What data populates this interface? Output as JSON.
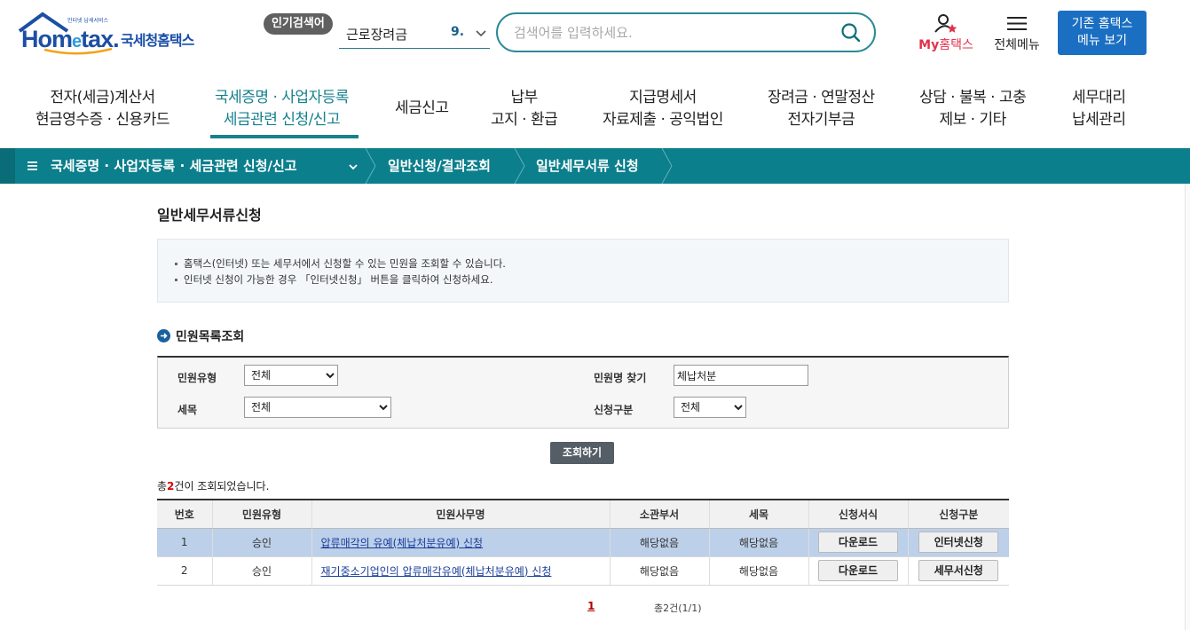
{
  "header": {
    "logo_tagline": "인터넷 납세서비스",
    "logo_word_a": "Hom",
    "logo_word_e": "e",
    "logo_word_b": "tax.",
    "logo_korean": "국세청홈택스",
    "popular_badge": "인기검색어",
    "popular_term": "근로장려금",
    "popular_rank": "9.",
    "search_placeholder": "검색어를 입력하세요.",
    "my_prefix": "My",
    "my_suffix": "홈택스",
    "all_menu": "전체메뉴",
    "old_menu_line1": "기존 홈택스",
    "old_menu_line2": "메뉴 보기"
  },
  "nav": {
    "items": [
      {
        "line1": "전자(세금)계산서",
        "line2": "현금영수증 · 신용카드"
      },
      {
        "line1": "국세증명 · 사업자등록",
        "line2": "세금관련 신청/신고"
      },
      {
        "line1": "세금신고",
        "line2": ""
      },
      {
        "line1": "납부",
        "line2": "고지 · 환급"
      },
      {
        "line1": "지급명세서",
        "line2": "자료제출 · 공익법인"
      },
      {
        "line1": "장려금 · 연말정산",
        "line2": "전자기부금"
      },
      {
        "line1": "상담 · 불복 · 고충",
        "line2": "제보 · 기타"
      },
      {
        "line1": "세무대리",
        "line2": "납세관리"
      }
    ]
  },
  "breadcrumb": {
    "level1": "국세증명 · 사업자등록 · 세금관련 신청/신고",
    "level2": "일반신청/결과조회",
    "level3": "일반세무서류 신청"
  },
  "page": {
    "title": "일반세무서류신청",
    "notice_1": "홈택스(인터넷) 또는 세무서에서 신청할 수 있는 민원을 조회할 수 있습니다.",
    "notice_2": "인터넷 신청이 가능한 경우 「인터넷신청」 버튼을 클릭하여 신청하세요.",
    "section_title": "민원목록조회"
  },
  "filter": {
    "type_label": "민원유형",
    "type_value": "전체",
    "name_label": "민원명 찾기",
    "name_value": "체납처분",
    "tax_label": "세목",
    "tax_value": "전체",
    "apply_label": "신청구분",
    "apply_value": "전체",
    "search_button": "조회하기"
  },
  "result": {
    "prefix": "총",
    "count": "2",
    "suffix": "건이 조회되었습니다."
  },
  "table": {
    "headers": [
      "번호",
      "민원유형",
      "민원사무명",
      "소관부서",
      "세목",
      "신청서식",
      "신청구분"
    ],
    "rows": [
      {
        "no": "1",
        "type": "승인",
        "name": "압류매각의 유예(체납처분유예) 신청",
        "dept": "해당없음",
        "tax": "해당없음",
        "form": "다운로드",
        "apply": "인터넷신청"
      },
      {
        "no": "2",
        "type": "승인",
        "name": "재기중소기업인의 압류매각유예(체납처분유예) 신청",
        "dept": "해당없음",
        "tax": "해당없음",
        "form": "다운로드",
        "apply": "세무서신청"
      }
    ]
  },
  "pagination": {
    "current": "1",
    "info": "총2건(1/1)"
  }
}
